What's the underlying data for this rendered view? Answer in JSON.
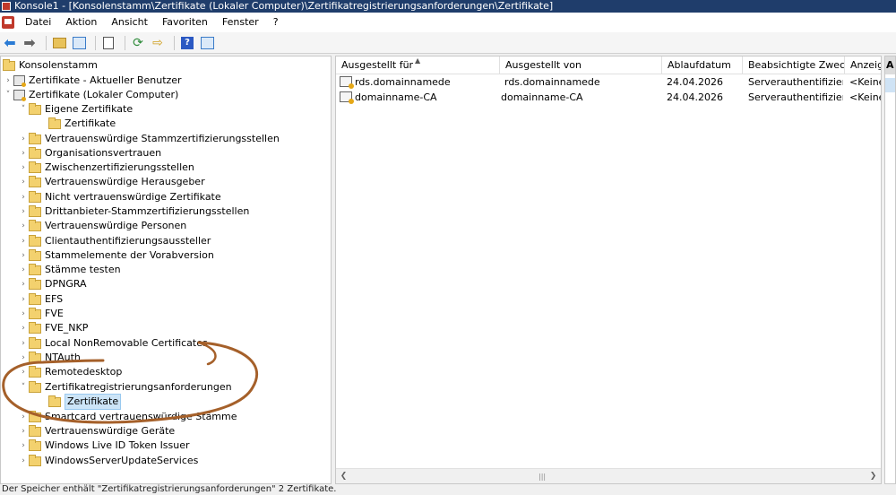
{
  "window": {
    "title": "Konsole1 - [Konsolenstamm\\Zertifikate (Lokaler Computer)\\Zertifikatregistrierungsanforderungen\\Zertifikate]"
  },
  "menu": [
    "Datei",
    "Aktion",
    "Ansicht",
    "Favoriten",
    "Fenster",
    "?"
  ],
  "toolbar": {
    "icons": [
      "back-arrow-icon",
      "forward-arrow-icon",
      "up-folder-icon",
      "show-hide-tree-icon",
      "clipboard-icon",
      "refresh-icon",
      "export-list-icon",
      "help-icon",
      "action-pane-icon"
    ]
  },
  "tree": {
    "items": [
      {
        "label": "Konsolenstamm",
        "level": 0,
        "expander": "",
        "icon": "folder"
      },
      {
        "label": "Zertifikate - Aktueller Benutzer",
        "level": 0,
        "expander": ">",
        "icon": "cert-store"
      },
      {
        "label": "Zertifikate (Lokaler Computer)",
        "level": 0,
        "expander": "v",
        "icon": "cert-store"
      },
      {
        "label": "Eigene Zertifikate",
        "level": 1,
        "expander": "v",
        "icon": "folder"
      },
      {
        "label": "Zertifikate",
        "level": 2,
        "expander": "",
        "icon": "folder"
      },
      {
        "label": "Vertrauenswürdige Stammzertifizierungsstellen",
        "level": 1,
        "expander": ">",
        "icon": "folder"
      },
      {
        "label": "Organisationsvertrauen",
        "level": 1,
        "expander": ">",
        "icon": "folder"
      },
      {
        "label": "Zwischenzertifizierungsstellen",
        "level": 1,
        "expander": ">",
        "icon": "folder"
      },
      {
        "label": "Vertrauenswürdige Herausgeber",
        "level": 1,
        "expander": ">",
        "icon": "folder"
      },
      {
        "label": "Nicht vertrauenswürdige Zertifikate",
        "level": 1,
        "expander": ">",
        "icon": "folder"
      },
      {
        "label": "Drittanbieter-Stammzertifizierungsstellen",
        "level": 1,
        "expander": ">",
        "icon": "folder"
      },
      {
        "label": "Vertrauenswürdige Personen",
        "level": 1,
        "expander": ">",
        "icon": "folder"
      },
      {
        "label": "Clientauthentifizierungsaussteller",
        "level": 1,
        "expander": ">",
        "icon": "folder"
      },
      {
        "label": "Stammelemente der Vorabversion",
        "level": 1,
        "expander": ">",
        "icon": "folder"
      },
      {
        "label": "Stämme testen",
        "level": 1,
        "expander": ">",
        "icon": "folder"
      },
      {
        "label": "DPNGRA",
        "level": 1,
        "expander": ">",
        "icon": "folder"
      },
      {
        "label": "EFS",
        "level": 1,
        "expander": ">",
        "icon": "folder"
      },
      {
        "label": "FVE",
        "level": 1,
        "expander": ">",
        "icon": "folder"
      },
      {
        "label": "FVE_NKP",
        "level": 1,
        "expander": ">",
        "icon": "folder"
      },
      {
        "label": "Local NonRemovable Certificates",
        "level": 1,
        "expander": ">",
        "icon": "folder"
      },
      {
        "label": "NTAuth",
        "level": 1,
        "expander": ">",
        "icon": "folder"
      },
      {
        "label": "Remotedesktop",
        "level": 1,
        "expander": ">",
        "icon": "folder"
      },
      {
        "label": "Zertifikatregistrierungsanforderungen",
        "level": 1,
        "expander": "v",
        "icon": "folder"
      },
      {
        "label": "Zertifikate",
        "level": 2,
        "expander": "",
        "icon": "folder",
        "selected": true
      },
      {
        "label": "Smartcard vertrauenswürdige Stämme",
        "level": 1,
        "expander": ">",
        "icon": "folder"
      },
      {
        "label": "Vertrauenswürdige Geräte",
        "level": 1,
        "expander": ">",
        "icon": "folder"
      },
      {
        "label": "Windows Live ID Token Issuer",
        "level": 1,
        "expander": ">",
        "icon": "folder"
      },
      {
        "label": "WindowsServerUpdateServices",
        "level": 1,
        "expander": ">",
        "icon": "folder"
      }
    ]
  },
  "list": {
    "columns": [
      "Ausgestellt für",
      "Ausgestellt von",
      "Ablaufdatum",
      "Beabsichtigte Zwecke",
      "Anzeige"
    ],
    "rows": [
      [
        "rds.domainnamede",
        "rds.domainnamede",
        "24.04.2026",
        "Serverauthentifizier...",
        "<Keine"
      ],
      [
        "domainname-CA",
        "domainname-CA",
        "24.04.2026",
        "Serverauthentifizier...",
        "<Keine"
      ]
    ]
  },
  "action_pane": {
    "header": "A"
  },
  "status": {
    "text": "Der Speicher enthält \"Zertifikatregistrierungsanforderungen\" 2 Zertifikate."
  },
  "colors": {
    "titlebar": "#1f3d6b",
    "annotation": "#a5602a",
    "selection": "#cce4f7"
  }
}
